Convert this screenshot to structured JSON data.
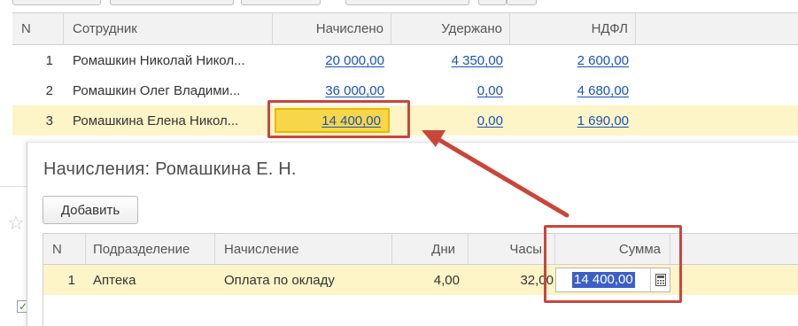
{
  "main_table": {
    "headers": {
      "n": "N",
      "employee": "Сотрудник",
      "accrued": "Начислено",
      "withheld": "Удержано",
      "tax": "НДФЛ"
    },
    "rows": [
      {
        "n": "1",
        "employee": "Ромашкин Николай Никол...",
        "accrued": "20 000,00",
        "withheld": "4 350,00",
        "tax": "2 600,00"
      },
      {
        "n": "2",
        "employee": "Ромашкин Олег Владими...",
        "accrued": "36 000,00",
        "withheld": "0,00",
        "tax": "4 680,00"
      },
      {
        "n": "3",
        "employee": "Ромашкина Елена Никол...",
        "accrued": "14 400,00",
        "withheld": "0,00",
        "tax": "1 690,00"
      }
    ],
    "selected_row": 3
  },
  "subform": {
    "title": "Начисления: Ромашкина Е. Н.",
    "add_button": "Добавить",
    "headers": {
      "n": "N",
      "department": "Подразделение",
      "accrual": "Начисление",
      "days": "Дни",
      "hours": "Часы",
      "sum": "Сумма"
    },
    "rows": [
      {
        "n": "1",
        "department": "Аптека",
        "accrual": "Оплата по окладу",
        "days": "4,00",
        "hours": "32,00",
        "sum": "14 400,00"
      }
    ]
  },
  "icons": {
    "calculator": "calculator-icon",
    "star": "star-icon",
    "checkbox": "checkbox-icon"
  },
  "colors": {
    "link": "#1a53b8",
    "selected_row": "#fdf4c8",
    "annotation": "#c9463a",
    "text_selection": "#3c5fc7"
  }
}
